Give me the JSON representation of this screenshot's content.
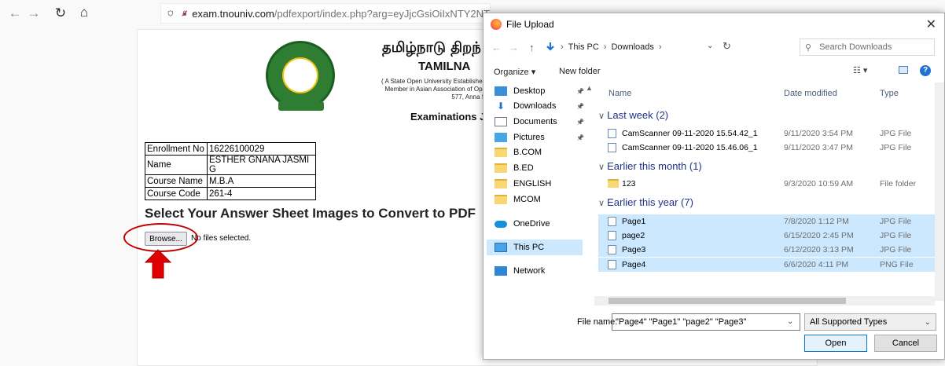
{
  "browser": {
    "url_host": "exam.tnouniv.com",
    "url_path": "/pdfexport/index.php?arg=eyJjcGsiOiIxNTY2NT"
  },
  "page": {
    "uni_name_tamil": "தமிழ்நாடு திறந்",
    "uni_name_english": "TAMILNA",
    "sub_line1": "( A State Open University Established",
    "sub_line2": "Member in Asian Association of Ope",
    "sub_line3": "577, Anna S",
    "exam_title": "Examinations J",
    "info_rows": [
      {
        "key": "Enrollment No",
        "value": "16226100029"
      },
      {
        "key": "Name",
        "value": "ESTHER GNANA JASMI G"
      },
      {
        "key": "Course Name",
        "value": "M.B.A"
      },
      {
        "key": "Course Code",
        "value": "261-4"
      }
    ],
    "select_heading": "Select Your Answer Sheet Images to Convert to PDF",
    "browse_label": "Browse...",
    "no_files_text": "No files selected."
  },
  "dialog": {
    "title": "File Upload",
    "path_root": "This PC",
    "path_folder": "Downloads",
    "search_placeholder": "Search Downloads",
    "organize_label": "Organize ▾",
    "new_folder_label": "New folder",
    "nav_items": [
      {
        "label": "Desktop",
        "icon": "desktop",
        "pinned": true
      },
      {
        "label": "Downloads",
        "icon": "down",
        "pinned": true
      },
      {
        "label": "Documents",
        "icon": "docs",
        "pinned": true
      },
      {
        "label": "Pictures",
        "icon": "pics",
        "pinned": true
      },
      {
        "label": "B.COM",
        "icon": "folder",
        "pinned": false
      },
      {
        "label": "B.ED",
        "icon": "folder",
        "pinned": false
      },
      {
        "label": "ENGLISH",
        "icon": "folder",
        "pinned": false
      },
      {
        "label": "MCOM",
        "icon": "folder",
        "pinned": false
      },
      {
        "label": "OneDrive",
        "icon": "onedrive",
        "pinned": false
      },
      {
        "label": "This PC",
        "icon": "pc",
        "pinned": false
      },
      {
        "label": "Network",
        "icon": "network",
        "pinned": false
      }
    ],
    "columns": {
      "name": "Name",
      "date": "Date modified",
      "type": "Type"
    },
    "groups": [
      {
        "label": "Last week (2)",
        "files": [
          {
            "name": "CamScanner 09-11-2020 15.54.42_1",
            "date": "9/11/2020 3:54 PM",
            "type": "JPG File",
            "selected": false,
            "folder": false
          },
          {
            "name": "CamScanner 09-11-2020 15.46.06_1",
            "date": "9/11/2020 3:47 PM",
            "type": "JPG File",
            "selected": false,
            "folder": false
          }
        ]
      },
      {
        "label": "Earlier this month (1)",
        "files": [
          {
            "name": "123",
            "date": "9/3/2020 10:59 AM",
            "type": "File folder",
            "selected": false,
            "folder": true
          }
        ]
      },
      {
        "label": "Earlier this year (7)",
        "files": [
          {
            "name": "Page1",
            "date": "7/8/2020 1:12 PM",
            "type": "JPG File",
            "selected": true,
            "folder": false
          },
          {
            "name": "page2",
            "date": "6/15/2020 2:45 PM",
            "type": "JPG File",
            "selected": true,
            "folder": false
          },
          {
            "name": "Page3",
            "date": "6/12/2020 3:13 PM",
            "type": "JPG File",
            "selected": true,
            "folder": false
          },
          {
            "name": "Page4",
            "date": "6/6/2020 4:11 PM",
            "type": "PNG File",
            "selected": true,
            "folder": false
          }
        ]
      }
    ],
    "file_name_label": "File name:",
    "file_name_value": "\"Page4\" \"Page1\" \"page2\" \"Page3\"",
    "file_type_value": "All Supported Types",
    "open_label": "Open",
    "cancel_label": "Cancel"
  },
  "colors": {
    "selection": "#cce8ff",
    "annotation": "#c00000",
    "group_header": "#1e3287"
  }
}
